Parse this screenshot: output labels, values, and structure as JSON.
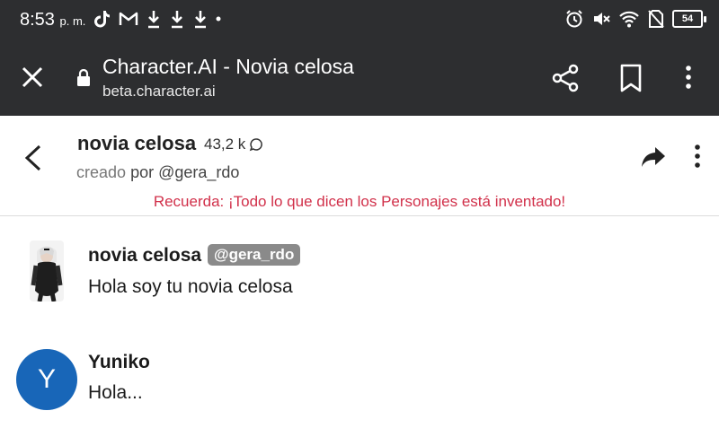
{
  "status_bar": {
    "time": "8:53",
    "ampm": "p. m.",
    "battery": "54",
    "left_icons": [
      "tiktok-icon",
      "gmail-icon",
      "download-icon",
      "download-icon",
      "download-icon",
      "dot-icon"
    ],
    "right_icons": [
      "alarm-icon",
      "mute-icon",
      "wifi-icon",
      "no-sim-icon",
      "battery-icon"
    ]
  },
  "browser": {
    "title": "Character.AI - Novia celosa",
    "url": "beta.character.ai"
  },
  "chat_header": {
    "character_name": "novia celosa",
    "interactions": "43,2 k",
    "created_prefix": "creado",
    "created_by": "por @gera_rdo",
    "reminder": "Recuerda: ¡Todo lo que dicen los Personajes está inventado!"
  },
  "messages": [
    {
      "name": "novia celosa",
      "badge": "@gera_rdo",
      "text": "Hola soy tu novia celosa",
      "avatar": "character-avatar"
    },
    {
      "name": "Yuniko",
      "text": "Hola...",
      "avatar_letter": "Y"
    }
  ],
  "colors": {
    "bar_bg": "#2d2e30",
    "reminder": "#d1304a",
    "user_avatar": "#1866b8",
    "badge_bg": "#8a8a8a"
  }
}
